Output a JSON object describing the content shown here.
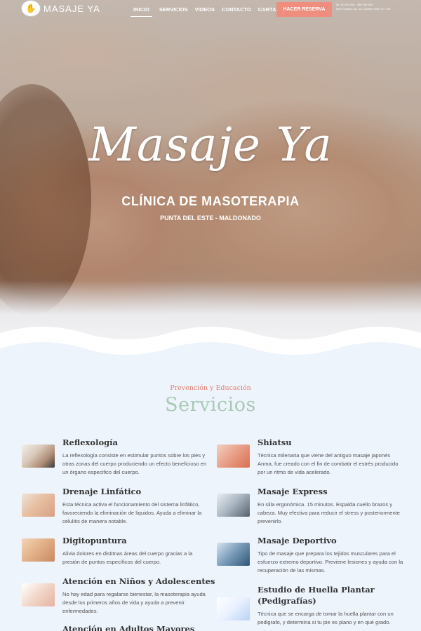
{
  "brand": {
    "name": "MASAJE YA"
  },
  "nav": {
    "items": [
      "INICIO",
      "SERVICIOS",
      "VIDEOS",
      "CONTACTO",
      "CARTA"
    ],
    "reserve_label": "HACER RESERVA",
    "contact_line1": "Tel: 42 444 000 - 099 535 549",
    "contact_line2": "Torre Gorlero Loc. 43, Gorlero entre 27 Y 28"
  },
  "hero": {
    "title": "Masaje Ya",
    "subtitle": "CLÍNICA DE MASOTERAPIA",
    "location": "PUNTA DEL ESTE - MALDONADO"
  },
  "services_section": {
    "eyebrow": "Prevención y Educación",
    "title": "Servicios"
  },
  "services_left": [
    {
      "name": "Reflexología",
      "desc": "La reflexología consiste en estimular puntos sobre los pies y otras zonas del cuerpo produciendo un efecto beneficioso en un órgano especifico del cuerpo."
    },
    {
      "name": "Drenaje Linfático",
      "desc": "Esta técnica activa el funcionamiento del sistema linfático, favoreciendo la eliminación de liquidos. Ayuda a eliminar la celulitis de manera notable."
    },
    {
      "name": "Digitopuntura",
      "desc": "Alivia dolores en distitnas áreas del cuerpo gracias a la presión de puntos específicos del cuerpo."
    },
    {
      "name": "Atención en Niños y Adolescentes",
      "desc": "No hay edad para regalarse bienestar, la masoterapia ayuda desde los primeros años de vida y ayuda a prevenir enfermedades."
    },
    {
      "name": "Atención en Adultos Mayores",
      "desc": ""
    }
  ],
  "services_right": [
    {
      "name": "Shiatsu",
      "desc": "Técnica milenaria que viene del antiguo masaje japonés Anma, fue creado con el fin de combatir el estrés producido por un ritmo de vida acelerado."
    },
    {
      "name": "Masaje Express",
      "desc": "En silla ergonómica. 15 minutos. Espalda cuello brazos y cabeza. Muy efectiva para reducir el stress y posteriormente prevenirlo."
    },
    {
      "name": "Masaje Deportivo",
      "desc": "Tipo de masaje que prepara los tejidos musculares para el esfuerzo extremo deportivo. Previene lesiones y ayuda con la recuperación de las mismas."
    },
    {
      "name": "Estudio de Huella Plantar",
      "name2": "(Pedigrafías)",
      "desc": "Técnica que se encarga de tomar la huella plantar con un pedigrafo, y determina si tu pie es plano y en qué grado."
    }
  ]
}
